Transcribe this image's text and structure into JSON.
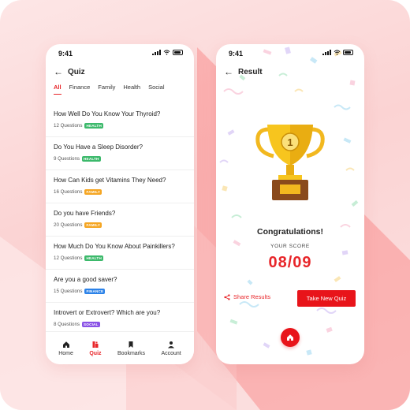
{
  "colors": {
    "accent": "#e8262a",
    "health": "#3cb96b",
    "family": "#f5a623",
    "finance": "#2b82e8",
    "social": "#8a52e6"
  },
  "quiz_screen": {
    "status_time": "9:41",
    "title": "Quiz",
    "tabs": [
      "All",
      "Finance",
      "Family",
      "Health",
      "Social"
    ],
    "active_tab": "All",
    "items": [
      {
        "question": "How Well Do You Know Your Thyroid?",
        "count": "12 Questions",
        "tag": "HEALTH"
      },
      {
        "question": "Do You Have a Sleep Disorder?",
        "count": "9 Questions",
        "tag": "HEALTH"
      },
      {
        "question": "How Can Kids get Vitamins They Need?",
        "count": "16 Questions",
        "tag": "FAMILY"
      },
      {
        "question": "Do you have Friends?",
        "count": "20 Questions",
        "tag": "FAMILY"
      },
      {
        "question": "How Much Do You Know About Painkillers?",
        "count": "12 Questions",
        "tag": "HEALTH"
      },
      {
        "question": "Are you a good saver?",
        "count": "15 Questions",
        "tag": "FINANCE"
      },
      {
        "question": "Introvert or Extrovert? Which are you?",
        "count": "8 Questions",
        "tag": "SOCIAL"
      }
    ],
    "nav": [
      {
        "label": "Home",
        "icon": "home-icon"
      },
      {
        "label": "Quiz",
        "icon": "quiz-icon"
      },
      {
        "label": "Bookmarks",
        "icon": "bookmark-icon"
      },
      {
        "label": "Account",
        "icon": "account-icon"
      }
    ],
    "active_nav": "Quiz"
  },
  "result_screen": {
    "status_time": "9:41",
    "title": "Result",
    "trophy_number": "1",
    "congrats": "Congratulations!",
    "score_label": "YOUR SCORE",
    "score": "08/09",
    "share_label": "Share Results",
    "new_quiz_label": "Take New Quiz"
  }
}
